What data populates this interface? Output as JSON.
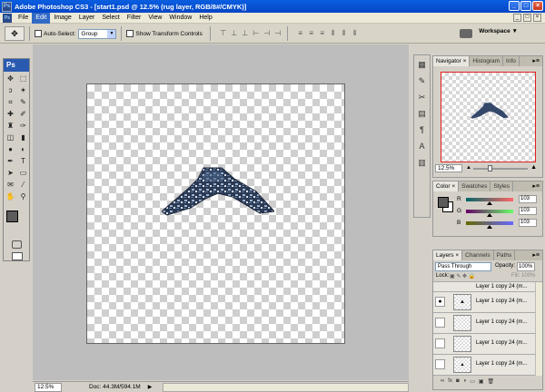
{
  "window": {
    "app_icon": "Ps",
    "title": "Adobe Photoshop CS3 - [start1.psd @ 12.5% (rug layer, RGB/8#/CMYK)]",
    "min_label": "_",
    "max_label": "□",
    "close_label": "×"
  },
  "menubar": {
    "items": [
      "File",
      "Edit",
      "Image",
      "Layer",
      "Select",
      "Filter",
      "View",
      "Window",
      "Help"
    ],
    "active": "Edit",
    "doc_min": "_",
    "doc_max": "□",
    "doc_close": "×"
  },
  "options_bar": {
    "auto_select_label": "Auto-Select:",
    "auto_select_value": "Group",
    "show_transform_label": "Show Transform Controls",
    "workspace_label": "Workspace ▼"
  },
  "toolbox": {
    "logo": "Ps",
    "tools": [
      {
        "name": "move-tool-icon",
        "glyph": "✥"
      },
      {
        "name": "marquee-tool-icon",
        "glyph": "⬚"
      },
      {
        "name": "lasso-tool-icon",
        "glyph": "ↄ"
      },
      {
        "name": "magic-wand-icon",
        "glyph": "✶"
      },
      {
        "name": "crop-tool-icon",
        "glyph": "⌗"
      },
      {
        "name": "slice-tool-icon",
        "glyph": "✎"
      },
      {
        "name": "healing-brush-icon",
        "glyph": "✚"
      },
      {
        "name": "brush-tool-icon",
        "glyph": "✐"
      },
      {
        "name": "clone-stamp-icon",
        "glyph": "♜"
      },
      {
        "name": "history-brush-icon",
        "glyph": "✑"
      },
      {
        "name": "eraser-icon",
        "glyph": "◫"
      },
      {
        "name": "gradient-icon",
        "glyph": "▮"
      },
      {
        "name": "blur-tool-icon",
        "glyph": "●"
      },
      {
        "name": "dodge-tool-icon",
        "glyph": "◐"
      },
      {
        "name": "pen-tool-icon",
        "glyph": "✒"
      },
      {
        "name": "type-tool-icon",
        "glyph": "T"
      },
      {
        "name": "path-select-icon",
        "glyph": "➤"
      },
      {
        "name": "shape-tool-icon",
        "glyph": "▭"
      },
      {
        "name": "notes-tool-icon",
        "glyph": "✉"
      },
      {
        "name": "eyedropper-icon",
        "glyph": "⁄"
      },
      {
        "name": "hand-tool-icon",
        "glyph": "✋"
      },
      {
        "name": "zoom-tool-icon",
        "glyph": "⚲"
      }
    ],
    "foreground_color": "#5b5b5b",
    "background_color": "#ffffff"
  },
  "canvas": {
    "workspace_bg": "#bdbdbd"
  },
  "status_bar": {
    "zoom": "12.5%",
    "doc_info": "Doc: 44.3M/594.1M",
    "arrow": "▶"
  },
  "icon_strip": {
    "icons": [
      "brush-presets-icon",
      "clone-source-icon",
      "tool-presets-icon",
      "layer-comps-icon",
      "paragraph-icon",
      "character-icon",
      "info-icon"
    ]
  },
  "navigator_panel": {
    "tabs": [
      "Navigator ×",
      "Histogram",
      "Info"
    ],
    "menu_icon": "▸≡",
    "zoom": "12.5%",
    "zoom_out": "▲",
    "zoom_in": "▲"
  },
  "color_panel": {
    "tabs": [
      "Color ×",
      "Swatches",
      "Styles"
    ],
    "menu_icon": "▸≡",
    "channels": [
      {
        "label": "R",
        "value": "103"
      },
      {
        "label": "G",
        "value": "103"
      },
      {
        "label": "B",
        "value": "103"
      }
    ]
  },
  "layers_panel": {
    "tabs": [
      "Layers ×",
      "Channels",
      "Paths"
    ],
    "menu_icon": "▸≡",
    "blend_mode": "Pass Through",
    "opacity_label": "Opacity:",
    "opacity_value": "100%",
    "lock_label": "Lock:",
    "lock_icons": "▣ ✎ ✥ 🔒",
    "fill_label": "Fill:",
    "fill_value": "100%",
    "layers": [
      {
        "name": "Layer 1 copy 24 (m...",
        "visible": true
      },
      {
        "name": "Layer 1 copy 24 (m...",
        "visible": false
      },
      {
        "name": "Layer 1 copy 24 (m...",
        "visible": false
      },
      {
        "name": "Layer 1 copy 24 (m...",
        "visible": false
      }
    ],
    "partial_layer": "Layer 1 copy 24 (m...",
    "footer_icons": [
      "link-icon",
      "fx-icon",
      "mask-icon",
      "adjustment-icon",
      "group-icon",
      "new-layer-icon",
      "trash-icon"
    ],
    "footer_glyphs": [
      "∞",
      "fx",
      "◙",
      "◑",
      "▭",
      "▣",
      "🗑"
    ]
  }
}
